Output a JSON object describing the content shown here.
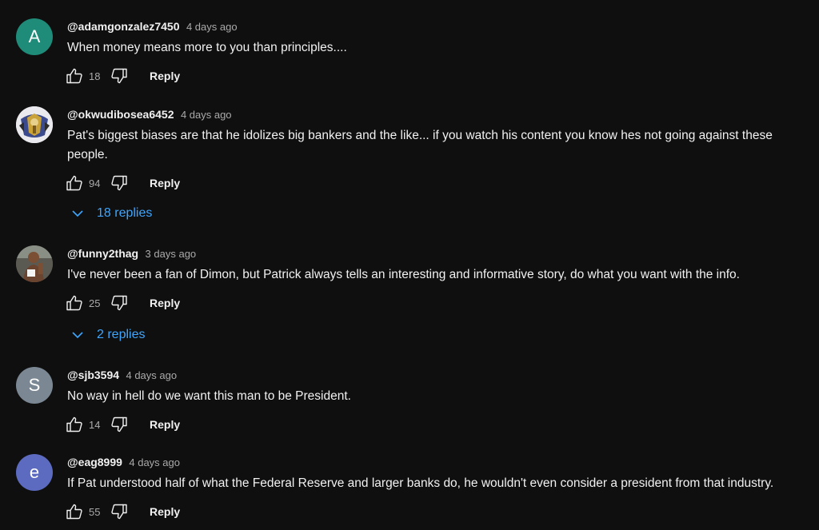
{
  "colors": {
    "background": "#0f0f0f",
    "text": "#f1f1f1",
    "secondary_text": "#aaaaaa",
    "link": "#3ea6ff"
  },
  "comments": [
    {
      "avatar_letter": "A",
      "avatar_color": "#1e8c78",
      "handle": "@adamgonzalez7450",
      "time": "4 days ago",
      "text": "When money means more to you than principles....",
      "likes": "18",
      "reply_label": "Reply"
    },
    {
      "avatar_icon": "emblem-photo-avatar",
      "handle": "@okwudibosea6452",
      "time": "4 days ago",
      "text": "Pat's biggest biases are that he idolizes big bankers and the like... if you watch his content you know hes not going against these people.",
      "likes": "94",
      "reply_label": "Reply",
      "replies_label": "18 replies"
    },
    {
      "avatar_icon": "person-photo-avatar",
      "handle": "@funny2thag",
      "time": "3 days ago",
      "text": "I've never been a fan of Dimon, but Patrick always tells an interesting and informative story, do what you want with the info.",
      "likes": "25",
      "reply_label": "Reply",
      "replies_label": "2 replies"
    },
    {
      "avatar_letter": "S",
      "avatar_color": "#7b8894",
      "handle": "@sjb3594",
      "time": "4 days ago",
      "text": "No way in hell do we want this man to be President.",
      "likes": "14",
      "reply_label": "Reply"
    },
    {
      "avatar_letter": "e",
      "avatar_color": "#5c6bc0",
      "handle": "@eag8999",
      "time": "4 days ago",
      "text": "If Pat understood half of what the Federal Reserve and larger banks do, he wouldn't even consider a president from that industry.",
      "likes": "55",
      "reply_label": "Reply"
    }
  ]
}
